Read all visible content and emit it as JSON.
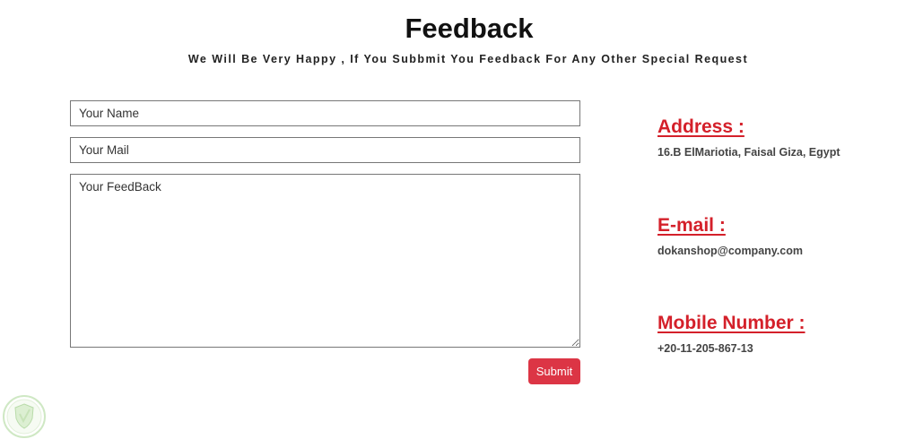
{
  "header": {
    "title": "Feedback",
    "subtitle": "We Will Be Very Happy , If You Subbmit You Feedback For Any Other Special Request"
  },
  "form": {
    "name_placeholder": "Your Name",
    "mail_placeholder": "Your Mail",
    "feedback_placeholder": "Your FeedBack",
    "submit_label": "Submit",
    "submit_color": "#dc3545"
  },
  "contact": {
    "address_heading": "Address :",
    "address_value": "16.B ElMariotia, Faisal Giza, Egypt",
    "email_heading": "E-mail :",
    "email_value": "dokanshop@company.com",
    "mobile_heading": "Mobile Number :",
    "mobile_value": "+20-11-205-867-13",
    "heading_color": "#d4202a"
  },
  "watermark": {
    "icon": "shield-logo-icon"
  }
}
